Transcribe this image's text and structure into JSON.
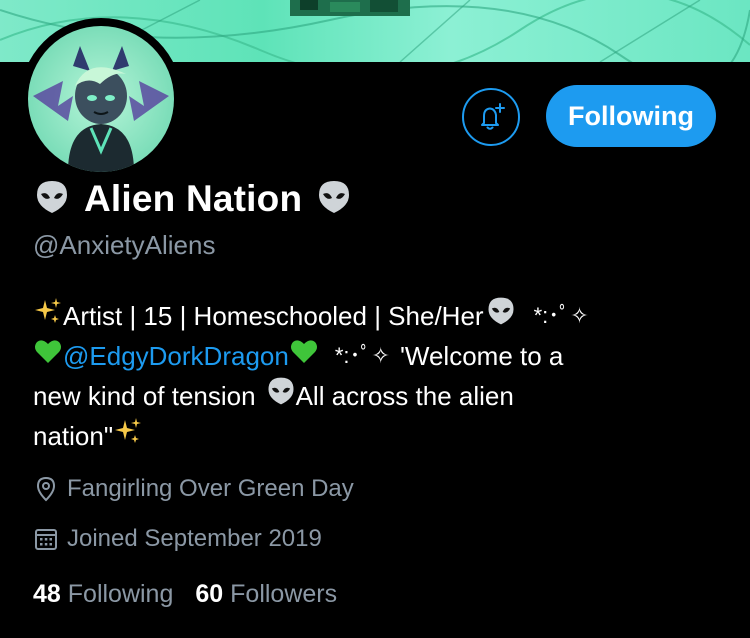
{
  "profile": {
    "display_name": "Alien Nation",
    "handle": "@AnxietyAliens",
    "bio": {
      "line1_text": "Artist | 15 | Homeschooled | She/Her",
      "line1_deco": "*:･ﾟ✧",
      "line2_mention": "@EdgyDorkDragon",
      "line2_deco": "*:･ﾟ✧",
      "line2_text": "'Welcome to a",
      "line3_text_a": "new kind of tension",
      "line3_text_b": "All across the alien",
      "line4_text": "nation\""
    },
    "location": "Fangirling Over Green Day",
    "joined": "Joined September 2019",
    "following_count": "48",
    "following_label": "Following",
    "followers_count": "60",
    "followers_label": "Followers"
  },
  "actions": {
    "follow_label": "Following"
  },
  "colors": {
    "accent": "#1d9bf0",
    "muted": "#8b98a5",
    "background": "#000000",
    "banner": "#7fe9c9"
  },
  "icons": [
    "alien-emoji-icon",
    "sparkles-emoji-icon",
    "green-heart-emoji-icon",
    "bell-plus-icon",
    "location-pin-icon",
    "calendar-icon"
  ]
}
